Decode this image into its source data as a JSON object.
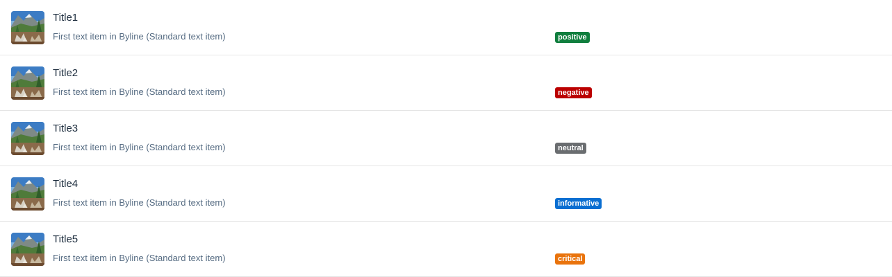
{
  "list": {
    "items": [
      {
        "title": "Title1",
        "byline": "First text item in Byline (Standard text item)",
        "status": "positive",
        "status_color": "#107e3e"
      },
      {
        "title": "Title2",
        "byline": "First text item in Byline (Standard text item)",
        "status": "negative",
        "status_color": "#bb0000"
      },
      {
        "title": "Title3",
        "byline": "First text item in Byline (Standard text item)",
        "status": "neutral",
        "status_color": "#6a6d70"
      },
      {
        "title": "Title4",
        "byline": "First text item in Byline (Standard text item)",
        "status": "informative",
        "status_color": "#0a6ed1"
      },
      {
        "title": "Title5",
        "byline": "First text item in Byline (Standard text item)",
        "status": "critical",
        "status_color": "#e9730c"
      }
    ],
    "thumbnail_icon": "landscape-thumbnail-icon"
  }
}
